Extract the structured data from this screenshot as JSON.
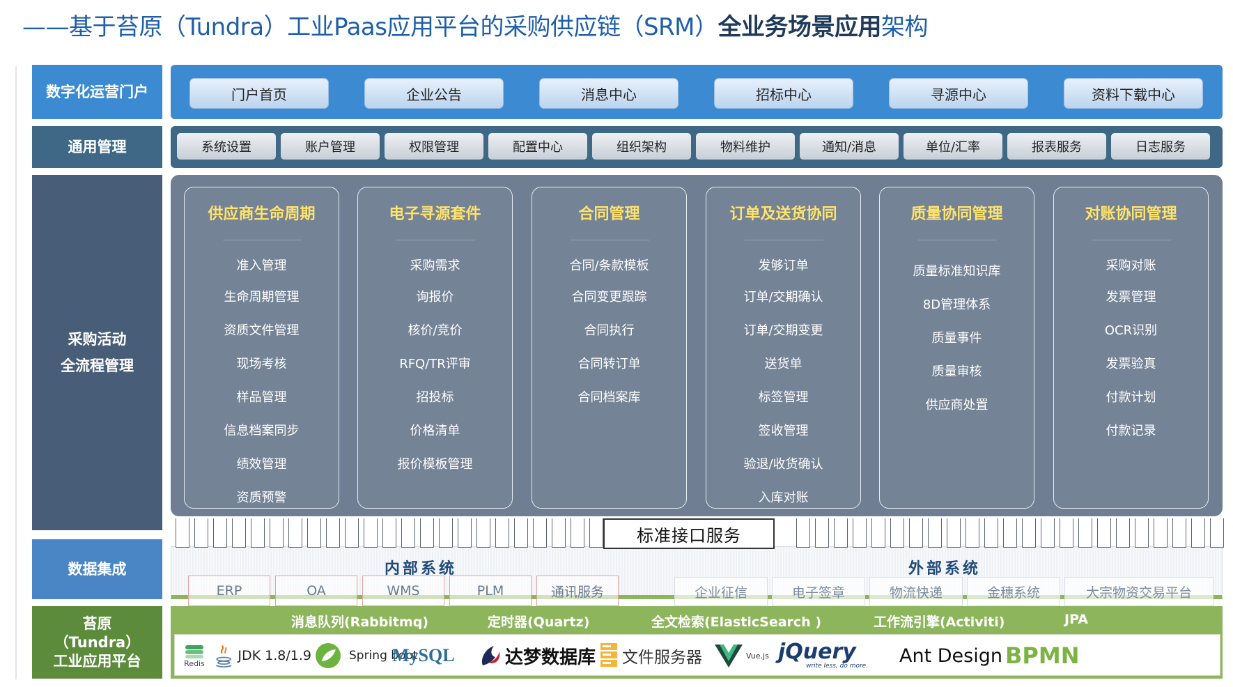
{
  "title": {
    "prefix": "——基于苔原（Tundra）工业Paas应用平台的采购供应链（SRM）",
    "bold": "全业务场景应用",
    "suffix": "架构"
  },
  "labels": {
    "portal": "数字化运营门户",
    "general": "通用管理",
    "proc_line1": "采购活动",
    "proc_line2": "全流程管理",
    "data": "数据集成",
    "platform_line1": "苔原",
    "platform_line2": "（Tundra）",
    "platform_line3": "工业应用平台"
  },
  "portal_items": [
    "门户首页",
    "企业公告",
    "消息中心",
    "招标中心",
    "寻源中心",
    "资料下载中心"
  ],
  "general_items": [
    "系统设置",
    "账户管理",
    "权限管理",
    "配置中心",
    "组织架构",
    "物料维护",
    "通知/消息",
    "单位/汇率",
    "报表服务",
    "日志服务"
  ],
  "modules": [
    {
      "title": "供应商生命周期",
      "items": [
        "准入管理",
        "生命周期管理",
        "资质文件管理",
        "现场考核",
        "样品管理",
        "信息档案同步",
        "绩效管理",
        "资质预警"
      ]
    },
    {
      "title": "电子寻源套件",
      "items": [
        "采购需求",
        "询报价",
        "核价/竞价",
        "RFQ/TR评审",
        "招投标",
        "价格清单",
        "报价模板管理"
      ]
    },
    {
      "title": "合同管理",
      "items": [
        "合同/条款模板",
        "合同变更跟踪",
        "合同执行",
        "合同转订单",
        "合同档案库"
      ]
    },
    {
      "title": "订单及送货协同",
      "items": [
        "发够订单",
        "订单/交期确认",
        "订单/交期变更",
        "送货单",
        "标签管理",
        "签收管理",
        "验退/收货确认",
        "入库对账"
      ]
    },
    {
      "title": "质量协同管理",
      "items": [
        "质量标准知识库",
        "8D管理体系",
        "质量事件",
        "质量审核",
        "供应商处置"
      ]
    },
    {
      "title": "对账协同管理",
      "items": [
        "采购对账",
        "发票管理",
        "OCR识别",
        "发票验真",
        "付款计划",
        "付款记录"
      ]
    }
  ],
  "api_service": "标准接口服务",
  "internal": {
    "title": "内部系统",
    "items": [
      "ERP",
      "OA",
      "WMS",
      "PLM",
      "通讯服务"
    ]
  },
  "external": {
    "title": "外部系统",
    "items": [
      "企业征信",
      "电子签章",
      "物流快递",
      "金穗系统",
      "大宗物资交易平台"
    ]
  },
  "platform_headers": [
    "消息队列(Rabbitmq)",
    "定时器(Quartz)",
    "全文检索(ElasticSearch )",
    "工作流引擎(Activiti)",
    "JPA"
  ],
  "tech": {
    "redis": "Redis",
    "jdk": "JDK 1.8/1.9",
    "spring": "Spring boot",
    "mysql": "MySQL",
    "dameng": "达梦数据库",
    "fileserver": "文件服务器",
    "vue": "Vue.js",
    "jquery": "jQuery",
    "jquery_tag": "write less, do more.",
    "antd": "Ant Design",
    "bpmn": "BPMN"
  },
  "colors": {
    "portal": "#3c8bd2",
    "general": "#3f6886",
    "process": "#6f7e92",
    "data": "#4a86c6",
    "platform": "#8db55c",
    "module_title": "#ffe36a"
  }
}
